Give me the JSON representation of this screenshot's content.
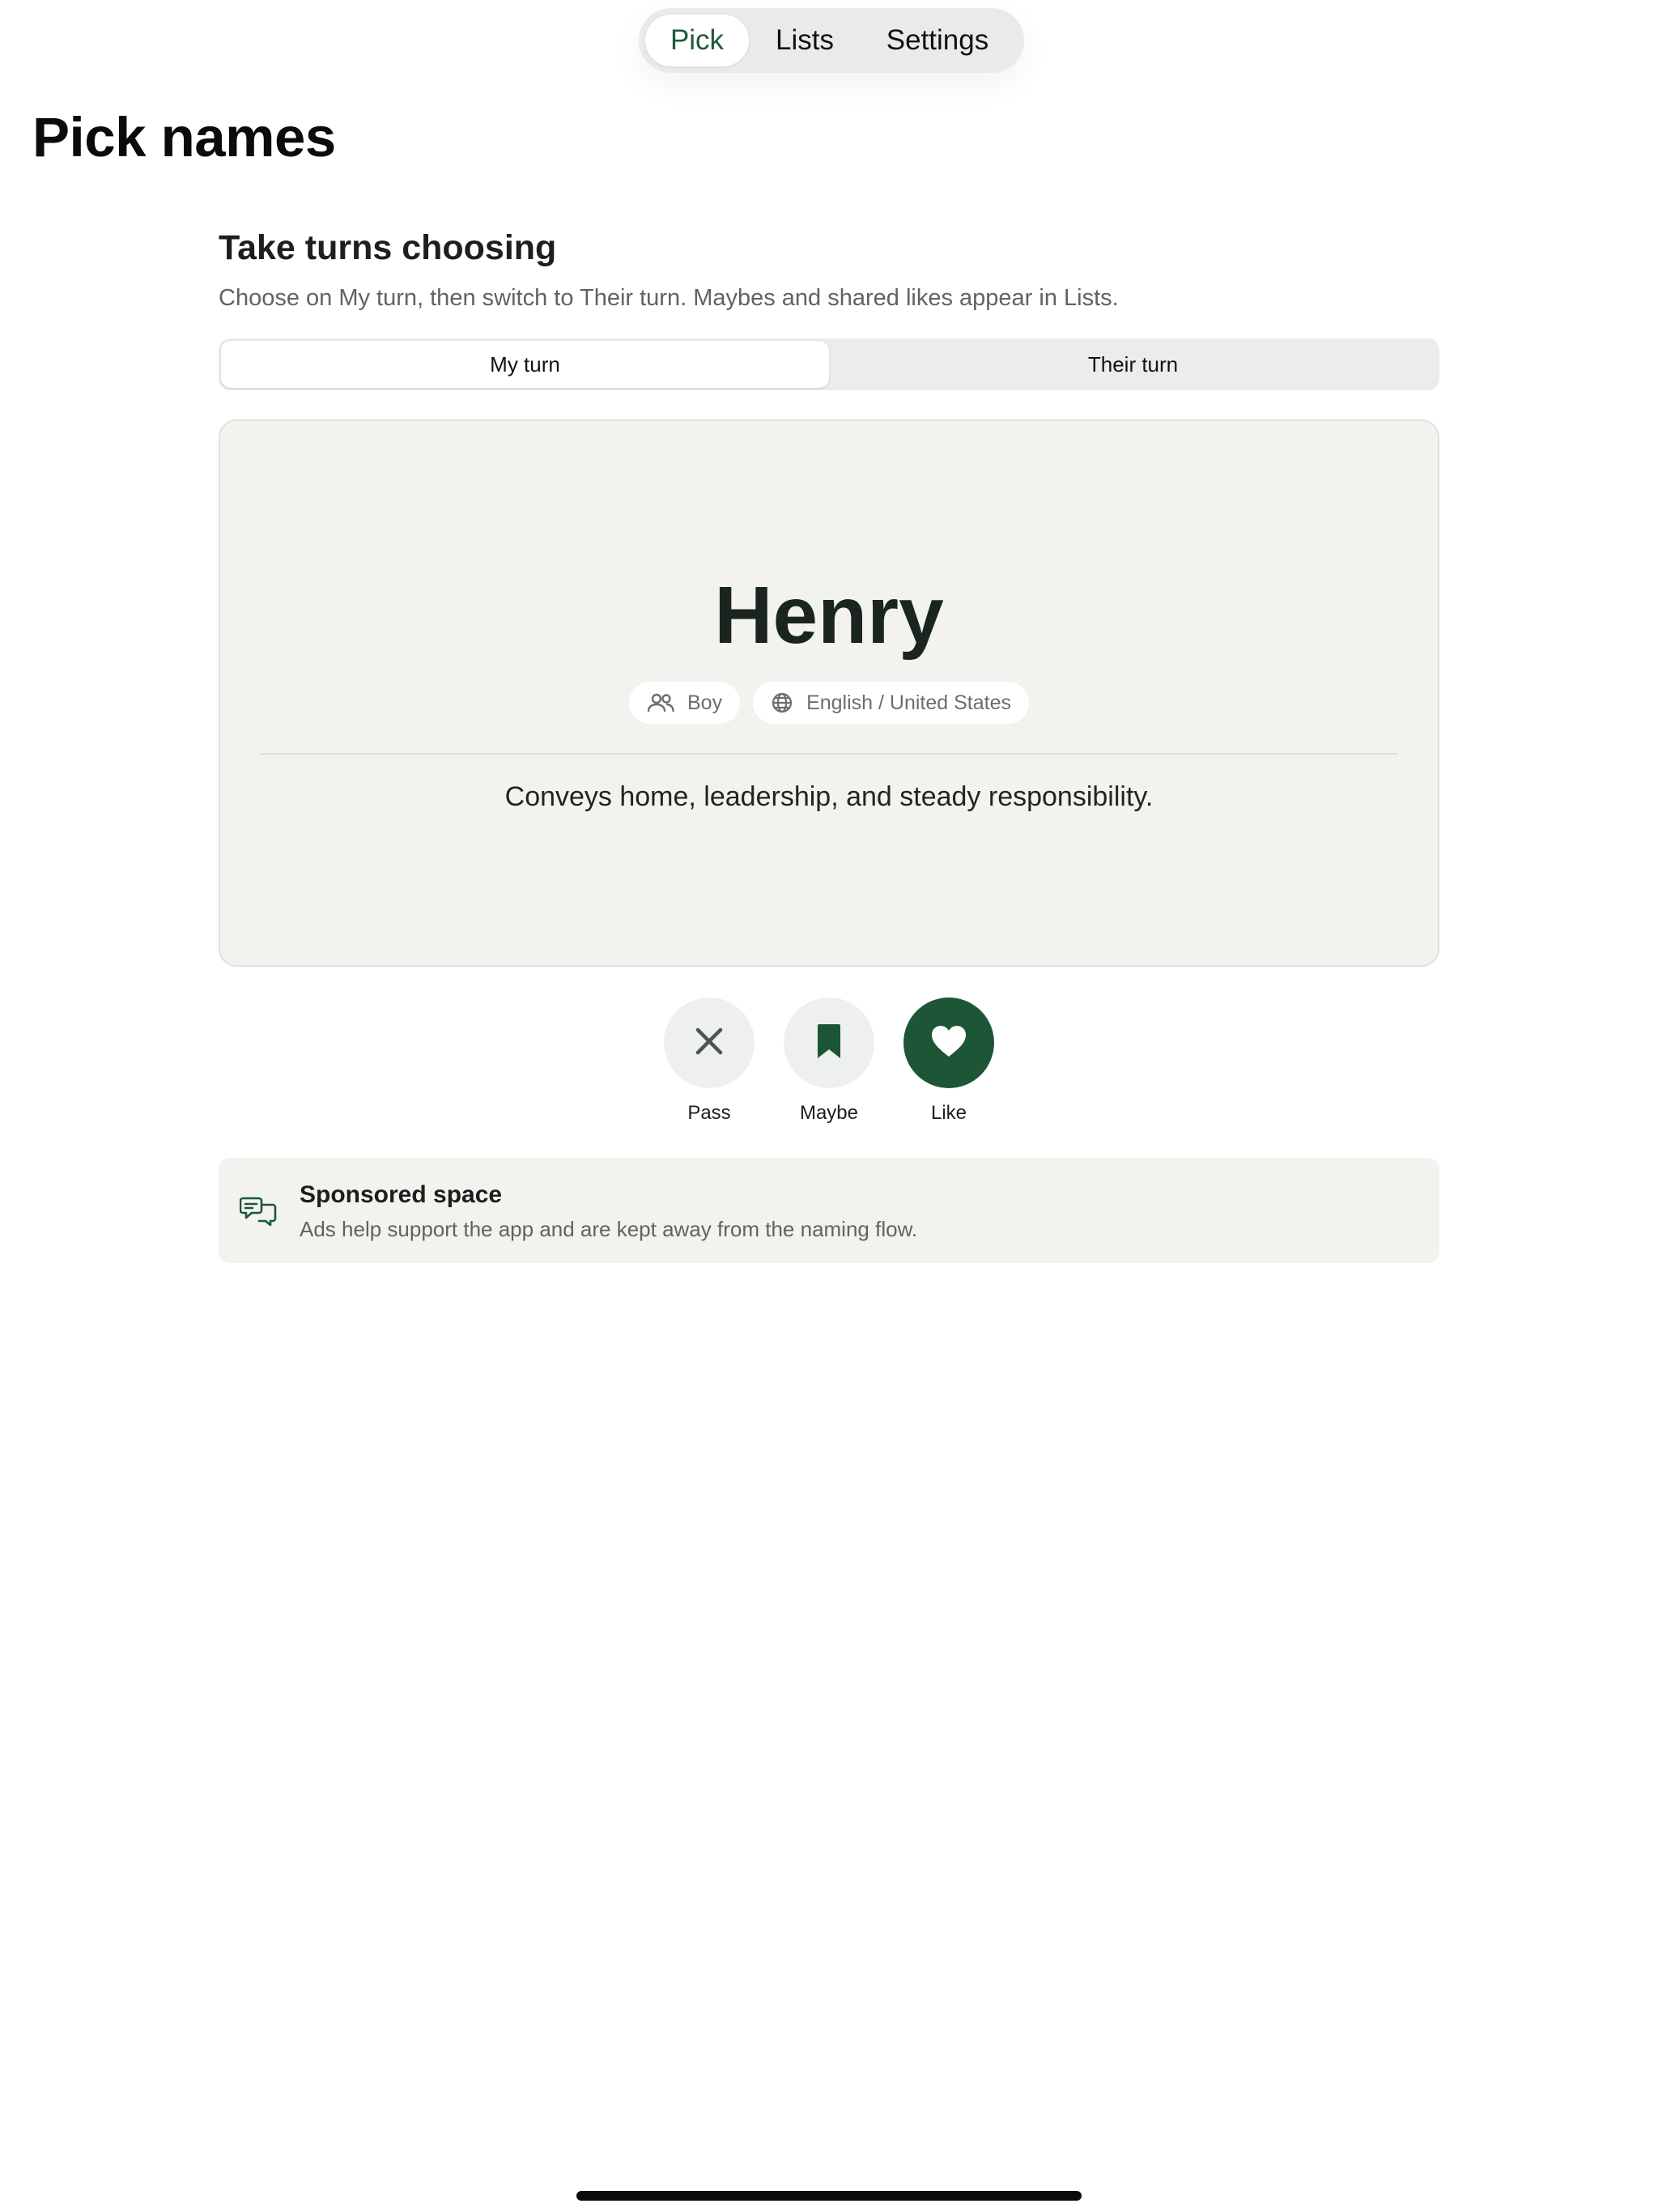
{
  "nav": {
    "tabs": [
      {
        "label": "Pick",
        "active": true
      },
      {
        "label": "Lists",
        "active": false
      },
      {
        "label": "Settings",
        "active": false
      }
    ]
  },
  "page": {
    "title": "Pick names"
  },
  "section": {
    "title": "Take turns choosing",
    "subtitle": "Choose on My turn, then switch to Their turn. Maybes and shared likes appear in Lists."
  },
  "turn_toggle": {
    "options": [
      "My turn",
      "Their turn"
    ],
    "selected": "My turn"
  },
  "name_card": {
    "name": "Henry",
    "gender_chip": {
      "label": "Boy",
      "icon": "people-icon"
    },
    "origin_chip": {
      "label": "English / United States",
      "icon": "globe-icon"
    },
    "meaning": "Conveys home, leadership, and steady responsibility."
  },
  "actions": {
    "pass": {
      "label": "Pass",
      "icon": "close-icon"
    },
    "maybe": {
      "label": "Maybe",
      "icon": "bookmark-icon"
    },
    "like": {
      "label": "Like",
      "icon": "heart-icon"
    }
  },
  "sponsored": {
    "title": "Sponsored space",
    "text": "Ads help support the app and are kept away from the naming flow.",
    "icon": "chat-ad-icon"
  },
  "colors": {
    "accent": "#1d5636",
    "card_background": "#f2f3ef",
    "muted_text": "#5e6461"
  }
}
